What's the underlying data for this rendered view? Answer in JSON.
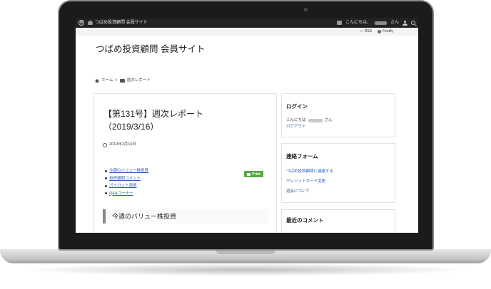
{
  "admin_bar": {
    "site_name": "つばめ投資顧問 会員サイト",
    "greeting": "こんにちは、",
    "honorific": "さん"
  },
  "feed_bar": {
    "rss": "RSS",
    "feedly": "Feedly"
  },
  "header": {
    "site_title": "つばめ投資顧問 会員サイト"
  },
  "breadcrumb": {
    "home": "ホーム",
    "separator": ">",
    "current": "週次レポート"
  },
  "post": {
    "title_line1": "【第131号】週次レポート",
    "title_line2": "（2019/3/16）",
    "date": "2019年3月16日",
    "toc": [
      "今週のバリュー株投資",
      "投資顧問コメント",
      "パイロット運用",
      "Q&Aコーナー"
    ],
    "print_label": "Print",
    "section_heading": "今週のバリュー株投資"
  },
  "sidebar": {
    "login": {
      "title": "ログイン",
      "greeting": "こんにちは",
      "honorific": "さん",
      "logout": "ログアウト"
    },
    "contact": {
      "title": "連絡フォーム",
      "links": [
        "つばめ投資顧問に連絡する",
        "クレジットカード変更",
        "退会について"
      ]
    },
    "comments": {
      "title": "最近のコメント"
    }
  },
  "colors": {
    "admin_bar": "#222222",
    "link": "#2a5db0",
    "print_button": "#57a845"
  }
}
